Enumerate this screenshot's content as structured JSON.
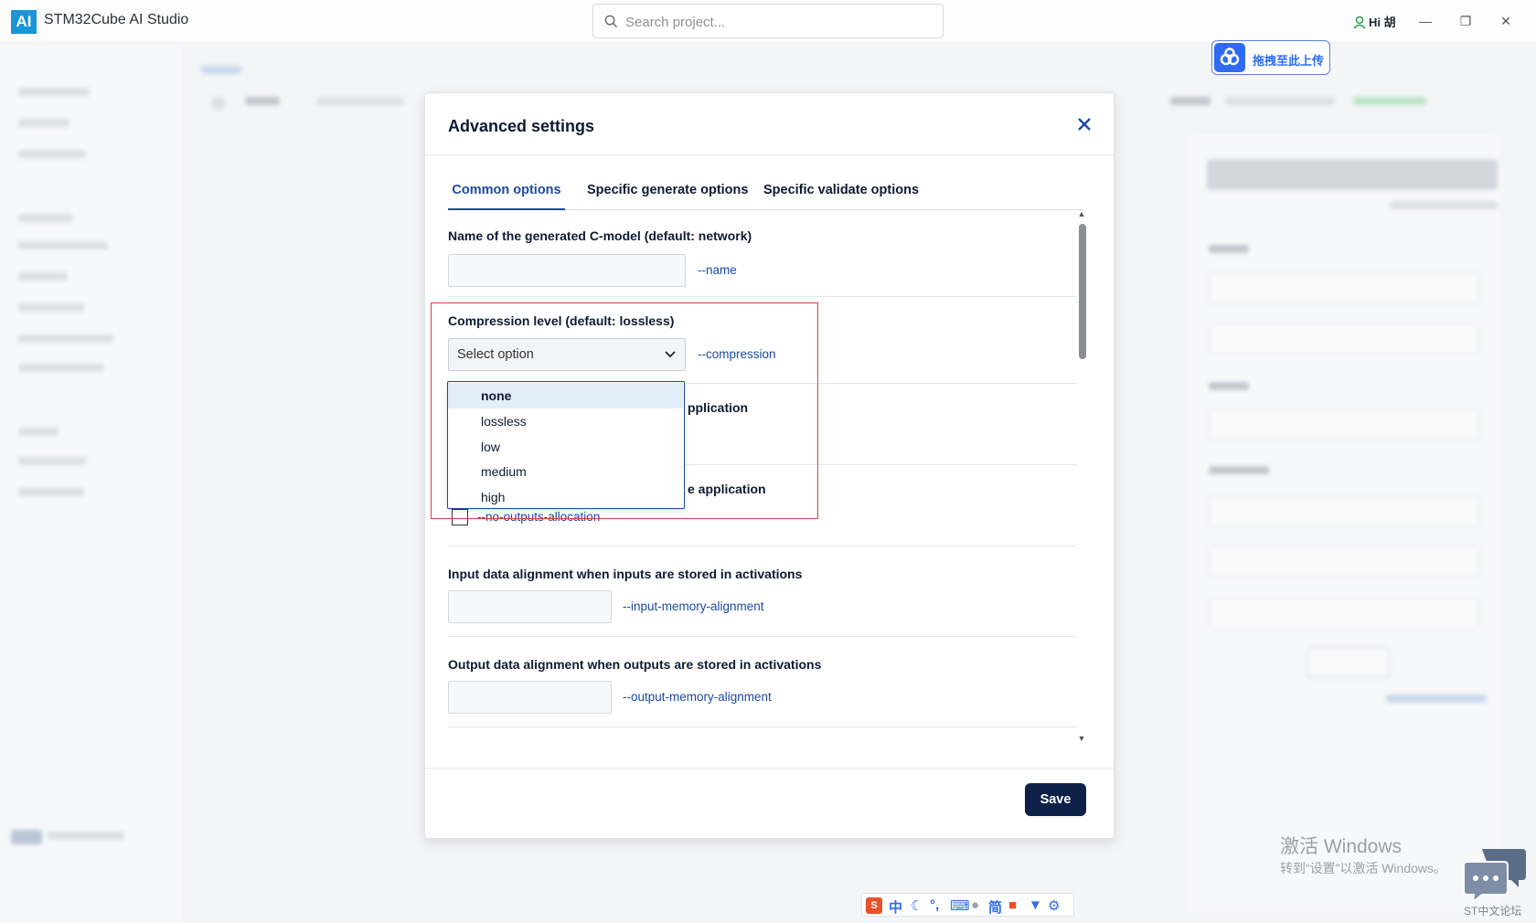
{
  "app": {
    "logo": "AI",
    "title": "STM32Cube AI Studio",
    "search_placeholder": "Search project...",
    "user_greeting": "Hi 胡"
  },
  "upload_widget": {
    "label": "拖拽至此上传"
  },
  "dialog": {
    "title": "Advanced settings",
    "tabs": [
      {
        "label": "Common options",
        "active": true
      },
      {
        "label": "Specific generate options",
        "active": false
      },
      {
        "label": "Specific validate options",
        "active": false
      }
    ],
    "fields": {
      "name": {
        "label": "Name of the generated C-model (default: network)",
        "flag": "--name",
        "value": ""
      },
      "compression": {
        "label": "Compression level (default: lossless)",
        "flag": "--compression",
        "placeholder": "Select option",
        "options": [
          "none",
          "lossless",
          "low",
          "medium",
          "high"
        ],
        "hovered_option": "none"
      },
      "inputs_alloc": {
        "label_tail": "pplication"
      },
      "outputs_alloc": {
        "label_tail": "e application",
        "flag": "--no-outputs-allocation",
        "checked": false
      },
      "input_alignment": {
        "label": "Input data alignment when inputs are stored in activations",
        "flag": "--input-memory-alignment",
        "value": ""
      },
      "output_alignment": {
        "label": "Output data alignment when outputs are stored in activations",
        "flag": "--output-memory-alignment",
        "value": ""
      }
    },
    "save_label": "Save"
  },
  "watermark": {
    "line1": "激活 Windows",
    "line2": "转到“设置”以激活 Windows。"
  },
  "ime_toolbar": {
    "items": [
      "中",
      "简"
    ]
  },
  "forum": {
    "label": "ST中文论坛"
  },
  "colors": {
    "accent": "#1b4aa0",
    "primary_button": "#0d2148",
    "highlight_box": "#e03c46",
    "app_logo": "#1a95d6"
  }
}
